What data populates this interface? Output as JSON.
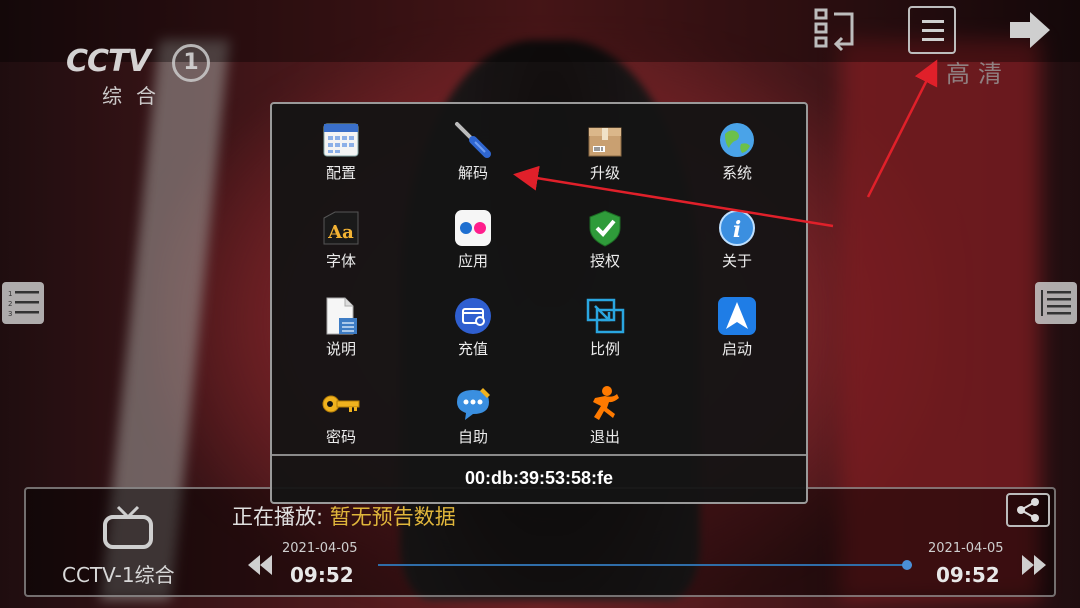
{
  "channel_logo": {
    "main": "CCTV",
    "number": "1",
    "sub": "综合"
  },
  "top_bar": {
    "quality_label": "高清",
    "icons": [
      "switch-source-icon",
      "menu-icon",
      "next-channel-icon"
    ]
  },
  "menu": {
    "items": [
      {
        "label": "配置",
        "icon": "calendar-icon"
      },
      {
        "label": "解码",
        "icon": "screwdriver-icon"
      },
      {
        "label": "升级",
        "icon": "package-icon"
      },
      {
        "label": "系统",
        "icon": "globe-icon"
      },
      {
        "label": "字体",
        "icon": "font-icon",
        "glyph": "Aa"
      },
      {
        "label": "应用",
        "icon": "flickr-icon"
      },
      {
        "label": "授权",
        "icon": "shield-check-icon"
      },
      {
        "label": "关于",
        "icon": "info-icon",
        "glyph": "i"
      },
      {
        "label": "说明",
        "icon": "document-icon"
      },
      {
        "label": "充值",
        "icon": "recharge-card-icon"
      },
      {
        "label": "比例",
        "icon": "aspect-ratio-icon"
      },
      {
        "label": "启动",
        "icon": "launch-arrow-icon"
      },
      {
        "label": "密码",
        "icon": "key-icon"
      },
      {
        "label": "自助",
        "icon": "chat-bubble-icon"
      },
      {
        "label": "退出",
        "icon": "running-man-icon"
      }
    ],
    "mac_address": "00:db:39:53:58:fe"
  },
  "bottom_bar": {
    "channel_name": "CCTV-1综合",
    "now_playing_label": "正在播放:",
    "now_playing_value": "暂无预告数据",
    "start_date": "2021-04-05",
    "start_time": "09:52",
    "end_date": "2021-04-05",
    "end_time": "09:52",
    "progress": 0.99
  },
  "colors": {
    "accent": "#e0b63b",
    "progress": "#2f6da8",
    "annotation": "#e0202a"
  }
}
